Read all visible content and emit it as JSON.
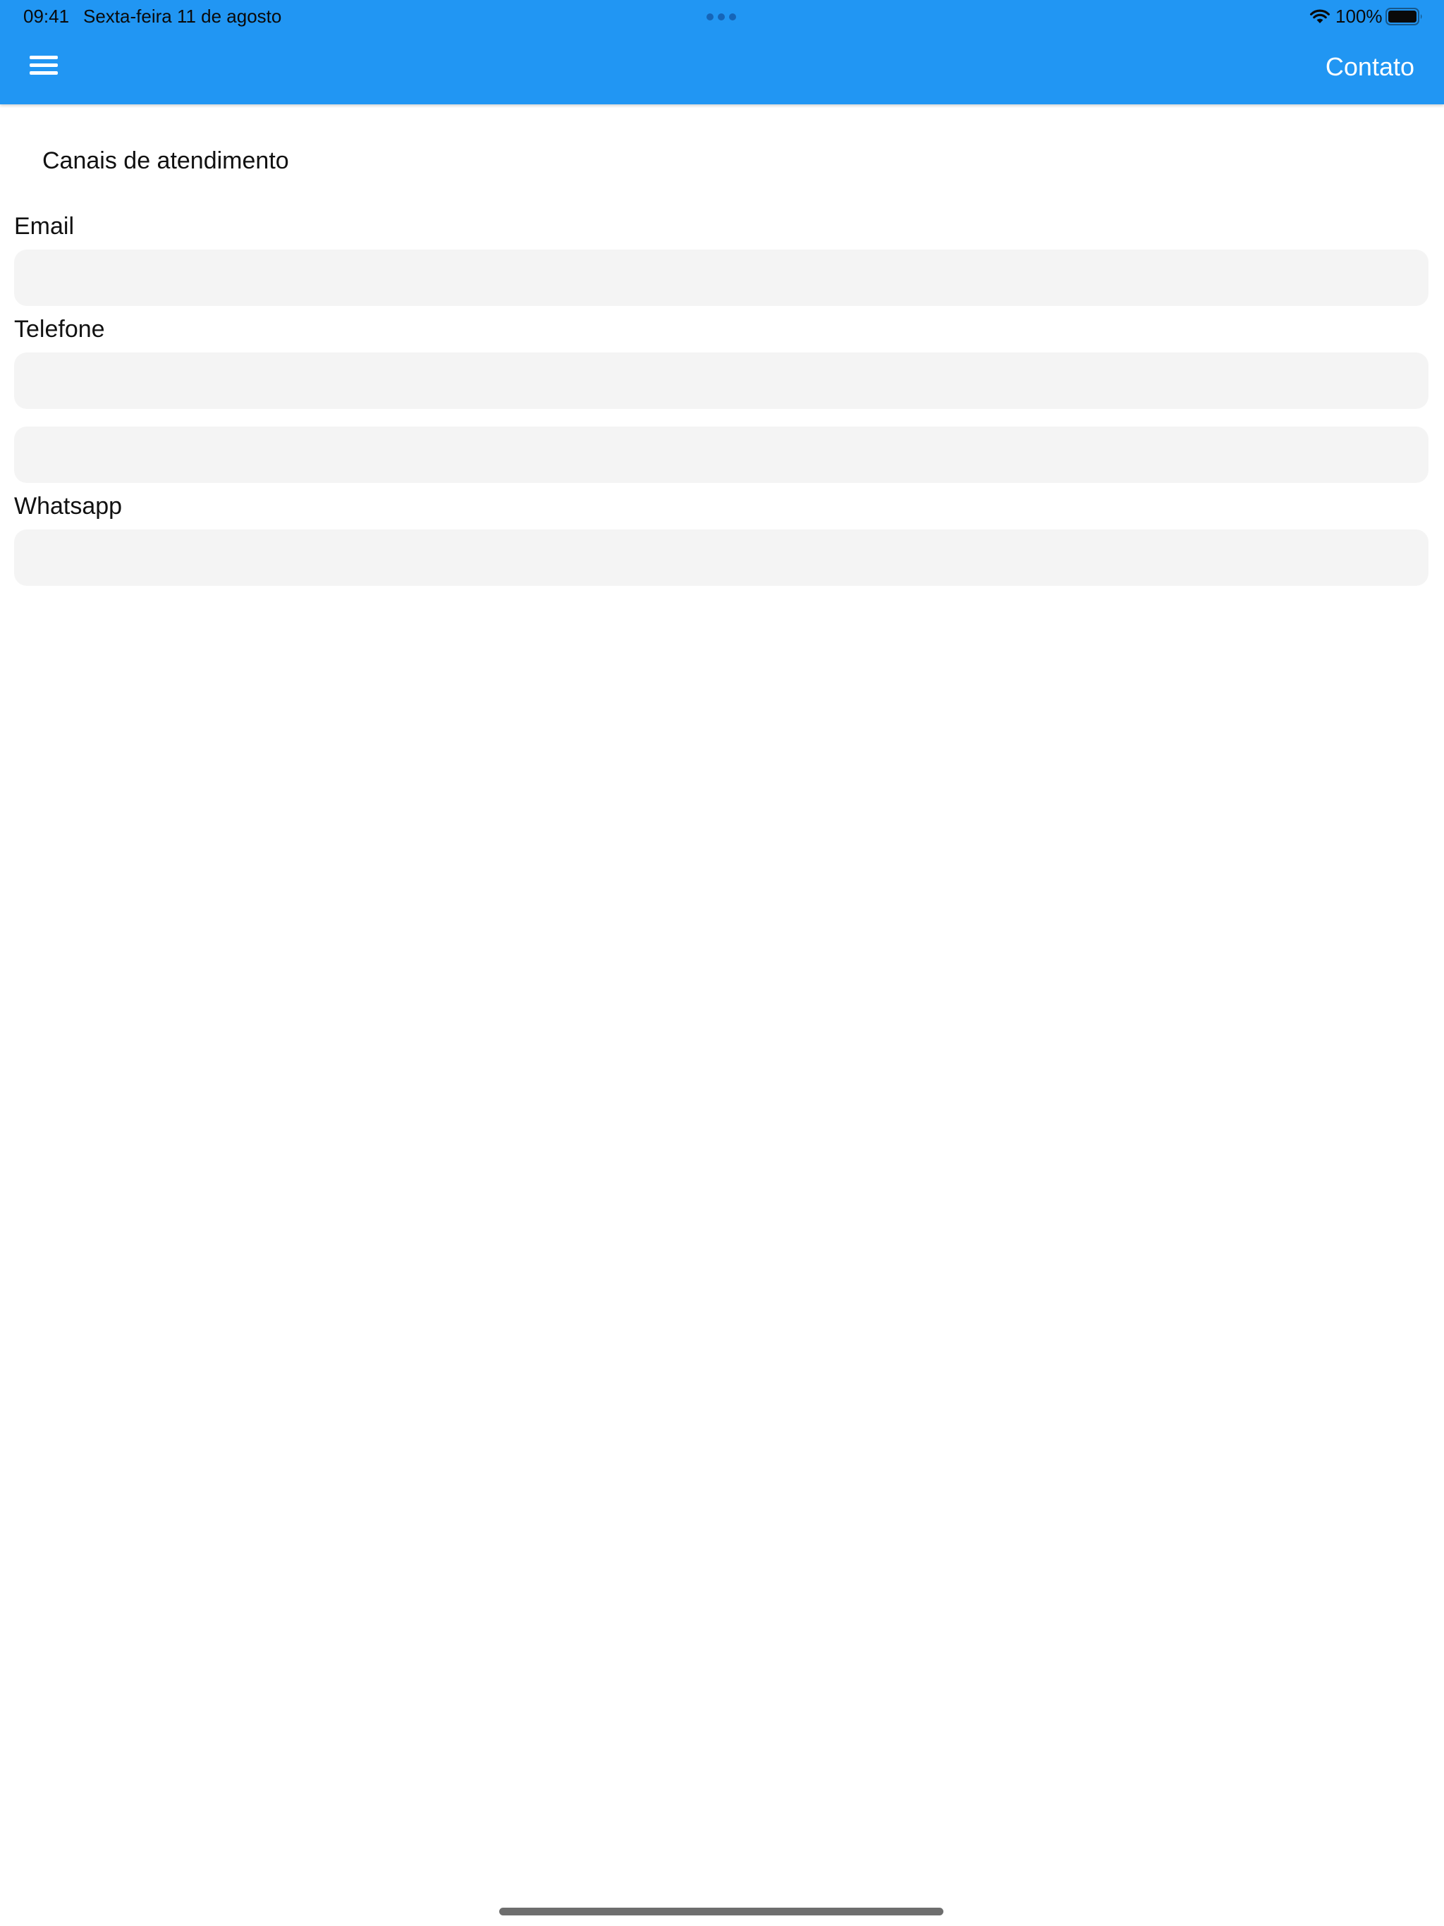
{
  "status_bar": {
    "time": "09:41",
    "date": "Sexta-feira 11 de agosto",
    "battery": "100%",
    "icons": [
      "wifi-icon",
      "battery-icon",
      "multitask-dots-icon"
    ]
  },
  "nav_bar": {
    "menu_icon": "hamburger-menu-icon",
    "title": "Contato",
    "background_color": "#2196F3",
    "text_color": "#FFFFFF"
  },
  "content": {
    "section_heading": "Canais de atendimento",
    "fields": [
      {
        "label": "Email",
        "value": "",
        "placeholder": ""
      },
      {
        "label": "Telefone",
        "value": "",
        "placeholder": ""
      },
      {
        "label": "",
        "value": "",
        "placeholder": ""
      },
      {
        "label": "Whatsapp",
        "value": "",
        "placeholder": ""
      }
    ]
  }
}
